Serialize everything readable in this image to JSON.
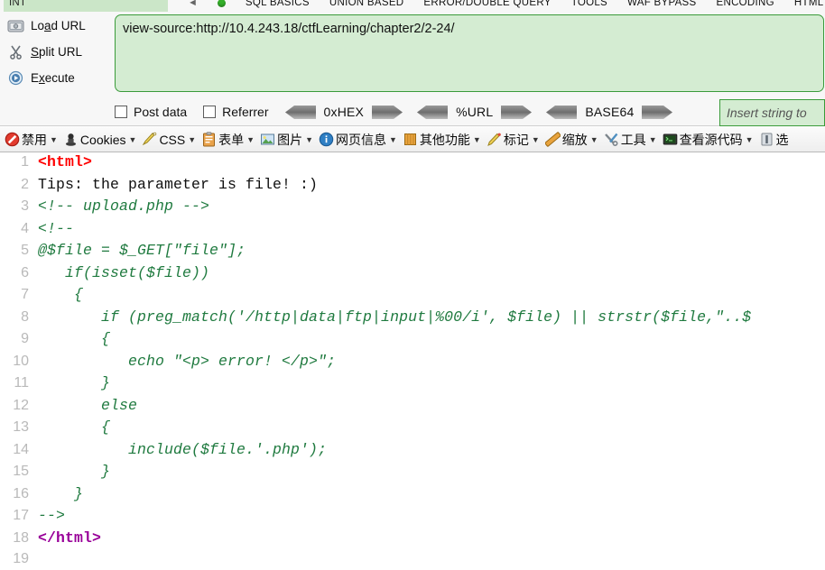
{
  "hackbar": {
    "menu": {
      "first_tab": "INT",
      "items": [
        "SQL BASICS",
        "UNION BASED",
        "ERROR/DOUBLE QUERY",
        "TOOLS",
        "WAF BYPASS",
        "ENCODING",
        "HTML"
      ]
    },
    "actions": [
      {
        "label_pre": "Lo",
        "label_key": "a",
        "label_post": "d URL",
        "icon": "load-url-icon"
      },
      {
        "label_pre": "",
        "label_key": "S",
        "label_post": "plit URL",
        "icon": "split-url-icon"
      },
      {
        "label_pre": "E",
        "label_key": "x",
        "label_post": "ecute",
        "icon": "execute-icon"
      }
    ],
    "url_value": "view-source:http://10.4.243.18/ctfLearning/chapter2/2-24/",
    "checkboxes": [
      {
        "label": "Post data",
        "checked": false
      },
      {
        "label": "Referrer",
        "checked": false
      }
    ],
    "encoders": [
      "0xHEX",
      "%URL",
      "BASE64"
    ],
    "insert_placeholder": "Insert string to"
  },
  "webdev_toolbar": {
    "items": [
      {
        "label": "禁用",
        "icon": "disable-icon"
      },
      {
        "label": "Cookies",
        "icon": "cookie-icon"
      },
      {
        "label": "CSS",
        "icon": "css-icon"
      },
      {
        "label": "表单",
        "icon": "form-icon"
      },
      {
        "label": "图片",
        "icon": "image-icon"
      },
      {
        "label": "网页信息",
        "icon": "info-icon"
      },
      {
        "label": "其他功能",
        "icon": "misc-icon"
      },
      {
        "label": "标记",
        "icon": "outline-icon"
      },
      {
        "label": "缩放",
        "icon": "resize-icon"
      },
      {
        "label": "工具",
        "icon": "tools-icon"
      },
      {
        "label": "查看源代码",
        "icon": "view-source-icon"
      },
      {
        "label": "选",
        "icon": "options-icon"
      }
    ]
  },
  "source_view": {
    "lines": [
      {
        "n": "1",
        "cls": "c-tag",
        "text": "<html>"
      },
      {
        "n": "2",
        "cls": "c-text",
        "text": "Tips: the parameter is file! :)"
      },
      {
        "n": "3",
        "cls": "c-com",
        "text": "<!-- upload.php -->"
      },
      {
        "n": "4",
        "cls": "c-com",
        "text": "<!--"
      },
      {
        "n": "5",
        "cls": "c-com",
        "text": "@$file = $_GET[\"file\"];"
      },
      {
        "n": "6",
        "cls": "c-com",
        "text": "   if(isset($file))"
      },
      {
        "n": "7",
        "cls": "c-com",
        "text": "    {"
      },
      {
        "n": "8",
        "cls": "c-com",
        "text": "       if (preg_match('/http|data|ftp|input|%00/i', $file) || strstr($file,\"..$"
      },
      {
        "n": "9",
        "cls": "c-com",
        "text": "       {"
      },
      {
        "n": "10",
        "cls": "c-com",
        "text": "          echo \"<p> error! </p>\";"
      },
      {
        "n": "11",
        "cls": "c-com",
        "text": "       }"
      },
      {
        "n": "12",
        "cls": "c-com",
        "text": "       else"
      },
      {
        "n": "13",
        "cls": "c-com",
        "text": "       {"
      },
      {
        "n": "14",
        "cls": "c-com",
        "text": "          include($file.'.php');"
      },
      {
        "n": "15",
        "cls": "c-com",
        "text": "       }"
      },
      {
        "n": "16",
        "cls": "c-com",
        "text": "    }"
      },
      {
        "n": "17",
        "cls": "c-com",
        "text": "-->"
      },
      {
        "n": "18",
        "cls": "c-tagc",
        "text": "</html>"
      },
      {
        "n": "19",
        "cls": "c-text",
        "text": ""
      }
    ]
  },
  "colors": {
    "hackbar_field_bg": "#d4ecd2",
    "hackbar_field_border": "#3a9b3a",
    "tag_red": "#ff0000",
    "tag_purple": "#990099",
    "comment_green": "#1f7a3f",
    "linenumber_gray": "#b9b9b9"
  }
}
